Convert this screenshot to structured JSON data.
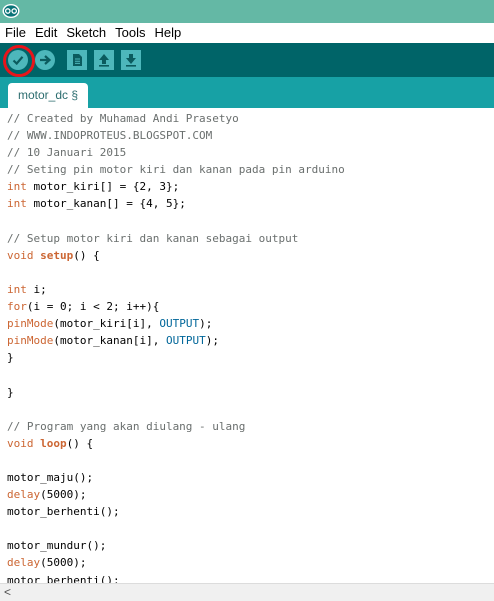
{
  "menu": {
    "items": [
      "File",
      "Edit",
      "Sketch",
      "Tools",
      "Help"
    ]
  },
  "toolbar": {
    "buttons": [
      {
        "name": "verify",
        "icon": "check-icon"
      },
      {
        "name": "upload",
        "icon": "arrow-right-icon"
      },
      {
        "name": "new",
        "icon": "new-document-icon"
      },
      {
        "name": "open",
        "icon": "arrow-up-icon"
      },
      {
        "name": "save",
        "icon": "arrow-down-icon"
      }
    ],
    "highlighted": "verify",
    "highlight_color": "#e8141a"
  },
  "tabs": [
    {
      "label": "motor_dc §",
      "active": true
    }
  ],
  "editor": {
    "lines": [
      [
        {
          "t": "// Created by Muhamad Andi Prasetyo",
          "c": "cmt"
        }
      ],
      [
        {
          "t": "// WWW.INDOPROTEUS.BLOGSPOT.COM",
          "c": "cmt"
        }
      ],
      [
        {
          "t": "// 10 Januari 2015",
          "c": "cmt"
        }
      ],
      [
        {
          "t": "// Seting pin motor kiri dan kanan pada pin arduino",
          "c": "cmt"
        }
      ],
      [
        {
          "t": "int",
          "c": "kw"
        },
        {
          "t": " motor_kiri[] = {2, 3};",
          "c": ""
        }
      ],
      [
        {
          "t": "int",
          "c": "kw"
        },
        {
          "t": " motor_kanan[] = {4, 5};",
          "c": ""
        }
      ],
      [],
      [
        {
          "t": "// Setup motor kiri dan kanan sebagai output",
          "c": "cmt"
        }
      ],
      [
        {
          "t": "void",
          "c": "kw"
        },
        {
          "t": " ",
          "c": ""
        },
        {
          "t": "setup",
          "c": "kwb"
        },
        {
          "t": "() {",
          "c": ""
        }
      ],
      [],
      [
        {
          "t": "int",
          "c": "kw"
        },
        {
          "t": " i;",
          "c": ""
        }
      ],
      [
        {
          "t": "for",
          "c": "kw"
        },
        {
          "t": "(i = 0; i < 2; i++){",
          "c": ""
        }
      ],
      [
        {
          "t": "pinMode",
          "c": "fn"
        },
        {
          "t": "(motor_kiri[i], ",
          "c": ""
        },
        {
          "t": "OUTPUT",
          "c": "const"
        },
        {
          "t": ");",
          "c": ""
        }
      ],
      [
        {
          "t": "pinMode",
          "c": "fn"
        },
        {
          "t": "(motor_kanan[i], ",
          "c": ""
        },
        {
          "t": "OUTPUT",
          "c": "const"
        },
        {
          "t": ");",
          "c": ""
        }
      ],
      [
        {
          "t": "}",
          "c": ""
        }
      ],
      [],
      [
        {
          "t": "}",
          "c": ""
        }
      ],
      [],
      [
        {
          "t": "// Program yang akan diulang - ulang",
          "c": "cmt"
        }
      ],
      [
        {
          "t": "void",
          "c": "kw"
        },
        {
          "t": " ",
          "c": ""
        },
        {
          "t": "loop",
          "c": "kwb"
        },
        {
          "t": "() {",
          "c": ""
        }
      ],
      [],
      [
        {
          "t": "motor_maju();",
          "c": ""
        }
      ],
      [
        {
          "t": "delay",
          "c": "fn"
        },
        {
          "t": "(5000);",
          "c": ""
        }
      ],
      [
        {
          "t": "motor_berhenti();",
          "c": ""
        }
      ],
      [],
      [
        {
          "t": "motor_mundur();",
          "c": ""
        }
      ],
      [
        {
          "t": "delay",
          "c": "fn"
        },
        {
          "t": "(5000);",
          "c": ""
        }
      ],
      [
        {
          "t": "motor_berhenti();",
          "c": ""
        }
      ]
    ]
  },
  "scrollbar": {
    "left_arrow": "<"
  },
  "colors": {
    "titlebar": "#64b8a5",
    "toolbar": "#006468",
    "tabbar": "#17a1a5",
    "button": "#4db7bb",
    "keyword": "#cc6633",
    "constant": "#006699",
    "comment": "#6a6f6e"
  }
}
